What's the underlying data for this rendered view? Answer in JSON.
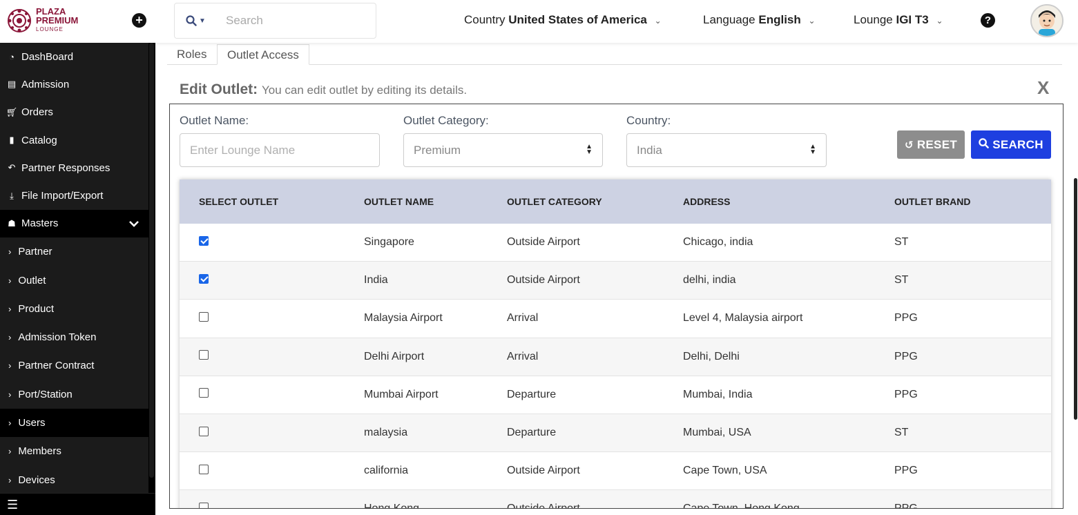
{
  "header": {
    "logo": {
      "line1": "PLAZA",
      "line2": "PREMIUM",
      "line3": "LOUNGE"
    },
    "search_placeholder": "Search",
    "country": {
      "label": "Country",
      "value": "United States of America"
    },
    "language": {
      "label": "Language",
      "value": "English"
    },
    "lounge": {
      "label": "Lounge",
      "value": "IGI T3"
    },
    "plus_glyph": "+",
    "help_glyph": "?"
  },
  "sidebar": {
    "items": [
      {
        "label": "DashBoard",
        "icon": "dashboard-icon"
      },
      {
        "label": "Admission",
        "icon": "id-card-icon"
      },
      {
        "label": "Orders",
        "icon": "cart-icon"
      },
      {
        "label": "Catalog",
        "icon": "file-icon"
      },
      {
        "label": "Partner Responses",
        "icon": "reply-all-icon"
      },
      {
        "label": "File Import/Export",
        "icon": "download-icon"
      }
    ],
    "masters": {
      "label": "Masters",
      "icon": "sitemap-icon"
    },
    "sub_items": [
      {
        "label": "Partner",
        "active": false
      },
      {
        "label": "Outlet",
        "active": false
      },
      {
        "label": "Product",
        "active": false
      },
      {
        "label": "Admission Token",
        "active": false
      },
      {
        "label": "Partner Contract",
        "active": false
      },
      {
        "label": "Port/Station",
        "active": false
      },
      {
        "label": "Users",
        "active": true
      },
      {
        "label": "Members",
        "active": false
      },
      {
        "label": "Devices",
        "active": false
      }
    ],
    "bottom_glyph": "☰"
  },
  "tabs": [
    {
      "label": "Roles",
      "active": false
    },
    {
      "label": "Outlet Access",
      "active": true
    }
  ],
  "edit": {
    "title": "Edit Outlet:",
    "subtitle": "You can edit outlet by editing its details.",
    "close": "X"
  },
  "filters": {
    "outlet_name": {
      "label": "Outlet Name:",
      "placeholder": "Enter Lounge Name"
    },
    "outlet_category": {
      "label": "Outlet Category:",
      "value": "Premium"
    },
    "country": {
      "label": "Country:",
      "value": "India"
    },
    "reset_label": "RESET",
    "search_label": "SEARCH"
  },
  "table": {
    "headers": [
      "SELECT OUTLET",
      "OUTLET NAME",
      "OUTLET CATEGORY",
      "ADDRESS",
      "OUTLET BRAND"
    ],
    "rows": [
      {
        "selected": true,
        "name": "Singapore",
        "category": "Outside Airport",
        "address": "Chicago, india",
        "brand": "ST"
      },
      {
        "selected": true,
        "name": "India",
        "category": "Outside Airport",
        "address": "delhi, india",
        "brand": "ST"
      },
      {
        "selected": false,
        "name": "Malaysia Airport",
        "category": "Arrival",
        "address": "Level 4, Malaysia airport",
        "brand": "PPG"
      },
      {
        "selected": false,
        "name": "Delhi Airport",
        "category": "Arrival",
        "address": "Delhi, Delhi",
        "brand": "PPG"
      },
      {
        "selected": false,
        "name": "Mumbai Airport",
        "category": "Departure",
        "address": "Mumbai, India",
        "brand": "PPG"
      },
      {
        "selected": false,
        "name": "malaysia",
        "category": "Departure",
        "address": "Mumbai, USA",
        "brand": "ST"
      },
      {
        "selected": false,
        "name": "california",
        "category": "Outside Airport",
        "address": "Cape Town, USA",
        "brand": "PPG"
      },
      {
        "selected": false,
        "name": "Hong Kong",
        "category": "Outside Airport",
        "address": "Cape Town, Hong Kong",
        "brand": "PPG"
      }
    ]
  },
  "colors": {
    "brand": "#8a1538",
    "search_button": "#1e3fe0",
    "reset_button": "#8d8d8d",
    "table_header": "#cdd2e3",
    "checkbox_checked": "#1a66e8",
    "sidebar_bg": "#1b1b1b"
  }
}
